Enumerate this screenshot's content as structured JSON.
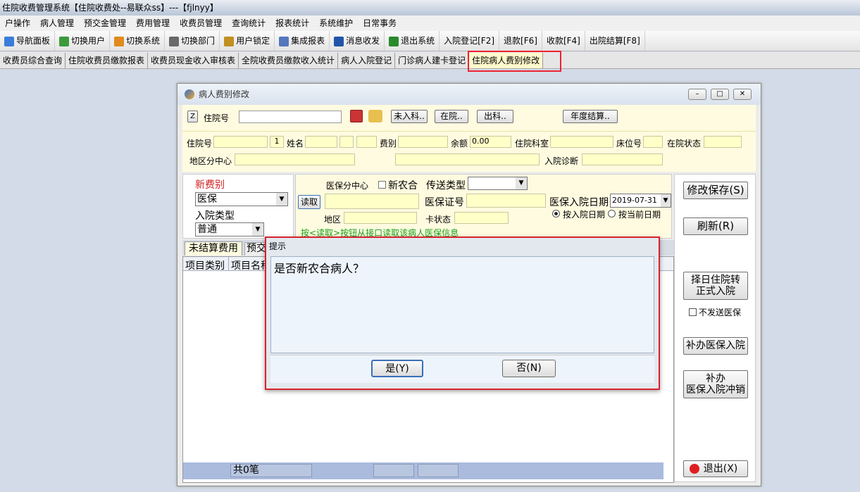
{
  "window": {
    "title": "住院收费管理系统【住院收费处--易联众ss】---【fjlnyy】"
  },
  "menu": [
    "户操作",
    "病人管理",
    "预交金管理",
    "费用管理",
    "收费员管理",
    "查询统计",
    "报表统计",
    "系统维护",
    "日常事务"
  ],
  "toolbar": [
    {
      "label": "导航面板",
      "icon": "nav-panel-icon",
      "color": "#3b7dd8"
    },
    {
      "label": "切换用户",
      "icon": "switch-user-icon",
      "color": "#3c9a3c"
    },
    {
      "label": "切换系统",
      "icon": "switch-system-icon",
      "color": "#e08a1e"
    },
    {
      "label": "切换部门",
      "icon": "switch-dept-icon",
      "color": "#6a6a6a"
    },
    {
      "label": "用户锁定",
      "icon": "user-lock-icon",
      "color": "#c09020"
    },
    {
      "label": "集成报表",
      "icon": "report-icon",
      "color": "#5577bb"
    },
    {
      "label": "消息收发",
      "icon": "message-icon",
      "color": "#2255aa"
    },
    {
      "label": "退出系统",
      "icon": "exit-icon",
      "color": "#2a8a2a"
    },
    {
      "label": "入院登记[F2]",
      "icon": "",
      "color": ""
    },
    {
      "label": "退款[F6]",
      "icon": "",
      "color": ""
    },
    {
      "label": "收款[F4]",
      "icon": "",
      "color": ""
    },
    {
      "label": "出院结算[F8]",
      "icon": "",
      "color": ""
    }
  ],
  "tabs": [
    "收费员综合查询",
    "住院收费员缴款报表",
    "收费员现金收入审核表",
    "全院收费员缴款收入统计",
    "病人入院登记",
    "门诊病人建卡登记",
    "住院病人费别修改"
  ],
  "active_tab": "住院病人费别修改",
  "dialog": {
    "title": "病人费别修改",
    "z_btn": "Z",
    "search_label": "住院号",
    "btn_not_admitted": "未入科..",
    "btn_in_hospital": "在院..",
    "btn_discharged": "出科..",
    "btn_annual": "年度结算..",
    "row1": {
      "zyh": "住院号",
      "zyh_seq": "1",
      "name": "姓名",
      "fee_type": "费别",
      "balance": "余额",
      "balance_val": "0.00",
      "dept": "住院科室",
      "bed": "床位号",
      "status": "在院状态"
    },
    "row2": {
      "region_center": "地区分中心",
      "diagnosis": "入院诊断"
    },
    "left": {
      "new_fee_label": "新费别",
      "new_fee_val": "医保",
      "admit_type_label": "入院类型",
      "admit_type_val": "普通"
    },
    "mid": {
      "center": "医保分中心",
      "xnh": "新农合",
      "send_type": "传送类型",
      "read_btn": "读取",
      "card_no": "医保证号",
      "admit_date_label": "医保入院日期",
      "admit_date": "2019-07-31",
      "region": "地区",
      "card_status": "卡状态",
      "radio1": "按入院日期",
      "radio2": "按当前日期",
      "hint": "按<读取>按钮从接口读取该病人医保信息"
    },
    "grid": {
      "tab1": "未结算费用",
      "tab2": "预交",
      "col1": "项目类别",
      "col2": "项目名称",
      "count": "共0笔"
    },
    "right": {
      "save": "修改保存(S)",
      "refresh": "刷新(R)",
      "transfer": "择日住院转正式入院",
      "no_send": "不发送医保",
      "supp_admit": "补办医保入院",
      "supp_cancel_l1": "补办",
      "supp_cancel_l2": "医保入院冲销",
      "exit": "退出(X)"
    }
  },
  "message": {
    "title": "提示",
    "text": "是否新农合病人？",
    "yes": "是(Y)",
    "no": "否(N)"
  }
}
